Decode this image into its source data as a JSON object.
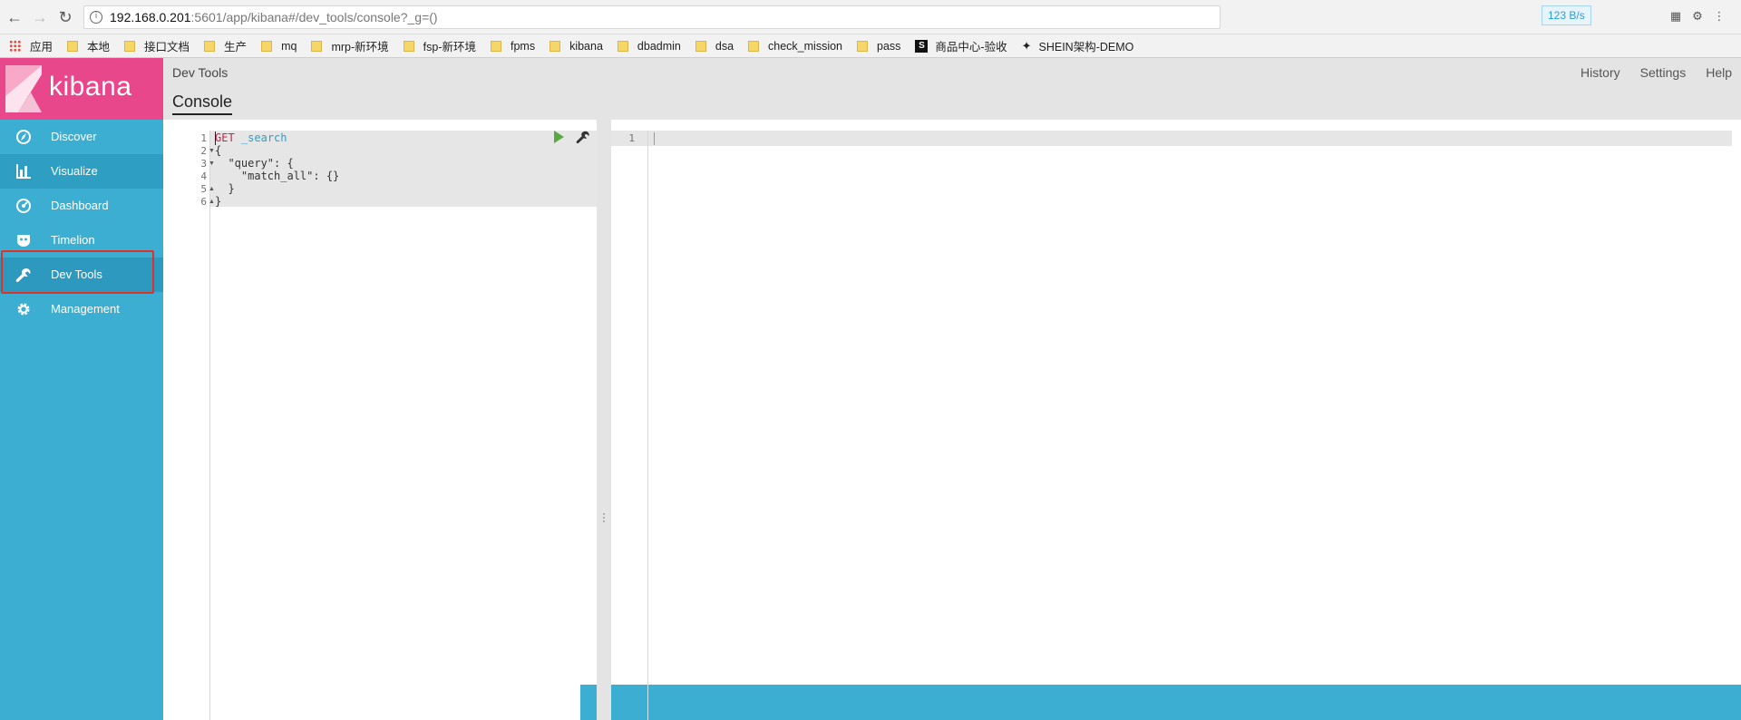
{
  "browser": {
    "url_host": "192.168.0.201",
    "url_rest": ":5601/app/kibana#/dev_tools/console?_g=()",
    "speed_badge": "123 B/s"
  },
  "bookmarks": [
    {
      "label": "应用",
      "type": "apps"
    },
    {
      "label": "本地",
      "type": "folder"
    },
    {
      "label": "接口文档",
      "type": "folder"
    },
    {
      "label": "生产",
      "type": "folder"
    },
    {
      "label": "mq",
      "type": "folder"
    },
    {
      "label": "mrp-新环境",
      "type": "folder"
    },
    {
      "label": "fsp-新环境",
      "type": "folder"
    },
    {
      "label": "fpms",
      "type": "folder"
    },
    {
      "label": "kibana",
      "type": "folder"
    },
    {
      "label": "dbadmin",
      "type": "folder"
    },
    {
      "label": "dsa",
      "type": "folder"
    },
    {
      "label": "check_mission",
      "type": "folder"
    },
    {
      "label": "pass",
      "type": "folder"
    },
    {
      "label": "商品中心-验收",
      "type": "s-badge"
    },
    {
      "label": "SHEIN架构-DEMO",
      "type": "star"
    }
  ],
  "kibana": {
    "logo_text": "kibana",
    "brand_color": "#e8488b",
    "sidebar_color": "#3caed2",
    "nav": [
      {
        "label": "Discover",
        "icon": "compass-icon"
      },
      {
        "label": "Visualize",
        "icon": "bar-chart-icon"
      },
      {
        "label": "Dashboard",
        "icon": "dashboard-icon"
      },
      {
        "label": "Timelion",
        "icon": "timelion-icon"
      },
      {
        "label": "Dev Tools",
        "icon": "wrench-icon"
      },
      {
        "label": "Management",
        "icon": "gear-icon"
      }
    ]
  },
  "header": {
    "app_title": "Dev Tools",
    "tab": "Console",
    "links": [
      "History",
      "Settings",
      "Help"
    ]
  },
  "request": {
    "line_numbers": [
      "1",
      "2",
      "3",
      "4",
      "5",
      "6"
    ],
    "method": "GET",
    "path": "_search",
    "line2": "{",
    "line3": "  \"query\": {",
    "line4": "    \"match_all\": {}",
    "line5": "  }",
    "line6": "}"
  },
  "response": {
    "line_numbers": [
      "1"
    ]
  }
}
